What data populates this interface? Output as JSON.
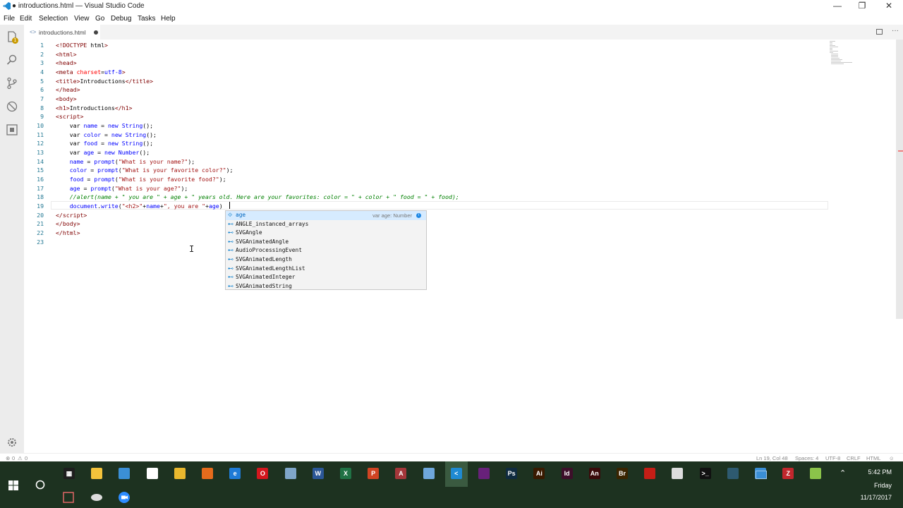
{
  "window": {
    "title": "● introductions.html — Visual Studio Code"
  },
  "menu": [
    "File",
    "Edit",
    "Selection",
    "View",
    "Go",
    "Debug",
    "Tasks",
    "Help"
  ],
  "activity": {
    "git_badge": "1"
  },
  "tab": {
    "label": "introductions.html"
  },
  "editor": {
    "line_numbers": [
      "1",
      "2",
      "3",
      "4",
      "5",
      "6",
      "7",
      "8",
      "9",
      "10",
      "11",
      "12",
      "13",
      "14",
      "15",
      "16",
      "17",
      "18",
      "19",
      "20",
      "21",
      "22",
      "23"
    ]
  },
  "suggest": {
    "items": [
      {
        "label": "age",
        "detail": "var age: Number"
      },
      {
        "label": "ANGLE_instanced_arrays"
      },
      {
        "label": "SVGAngle"
      },
      {
        "label": "SVGAnimatedAngle"
      },
      {
        "label": "AudioProcessingEvent"
      },
      {
        "label": "SVGAnimatedLength"
      },
      {
        "label": "SVGAnimatedLengthList"
      },
      {
        "label": "SVGAnimatedInteger"
      },
      {
        "label": "SVGAnimatedString"
      }
    ]
  },
  "status": {
    "errors": "0",
    "warnings": "0",
    "position": "Ln 19, Col 48",
    "spaces": "Spaces: 4",
    "encoding": "UTF-8",
    "eol": "CRLF",
    "language": "HTML"
  },
  "taskbar": {
    "time": "5:42 PM",
    "day": "Friday",
    "date": "11/17/2017",
    "apps": [
      {
        "name": "calculator",
        "color": "#1e1e1e",
        "glyph": "▦"
      },
      {
        "name": "file-explorer",
        "color": "#f3c33b",
        "glyph": ""
      },
      {
        "name": "cloud",
        "color": "#3b8fd6",
        "glyph": ""
      },
      {
        "name": "dropbox",
        "color": "#ffffff",
        "glyph": ""
      },
      {
        "name": "chrome",
        "color": "#e9b82e",
        "glyph": ""
      },
      {
        "name": "firefox",
        "color": "#e66b1c",
        "glyph": ""
      },
      {
        "name": "edge",
        "color": "#1f7bd6",
        "glyph": "e"
      },
      {
        "name": "opera",
        "color": "#d3171e",
        "glyph": "O"
      },
      {
        "name": "network",
        "color": "#7fa6c9",
        "glyph": ""
      },
      {
        "name": "word",
        "color": "#2b5797",
        "glyph": "W"
      },
      {
        "name": "excel",
        "color": "#207245",
        "glyph": "X"
      },
      {
        "name": "powerpoint",
        "color": "#d04423",
        "glyph": "P"
      },
      {
        "name": "access",
        "color": "#a4373a",
        "glyph": "A"
      },
      {
        "name": "paint",
        "color": "#6fa8dc",
        "glyph": ""
      },
      {
        "name": "vscode",
        "color": "#1f8ad2",
        "glyph": "<"
      },
      {
        "name": "visual-studio",
        "color": "#68217a",
        "glyph": ""
      },
      {
        "name": "photoshop",
        "color": "#0f2b40",
        "glyph": "Ps"
      },
      {
        "name": "illustrator",
        "color": "#3a1a00",
        "glyph": "Ai"
      },
      {
        "name": "indesign",
        "color": "#3d0f2a",
        "glyph": "Id"
      },
      {
        "name": "animate",
        "color": "#3a0a0a",
        "glyph": "An"
      },
      {
        "name": "bridge",
        "color": "#3a2400",
        "glyph": "Br"
      },
      {
        "name": "acrobat",
        "color": "#c41e16",
        "glyph": ""
      },
      {
        "name": "network-tool",
        "color": "#dddddd",
        "glyph": ""
      },
      {
        "name": "terminal",
        "color": "#111111",
        "glyph": ">_"
      },
      {
        "name": "brackets",
        "color": "#2e5a70",
        "glyph": ""
      },
      {
        "name": "monitor",
        "color": "#3b8fd6",
        "glyph": ""
      },
      {
        "name": "filezilla",
        "color": "#c1272d",
        "glyph": "Z"
      },
      {
        "name": "notepad-plus",
        "color": "#8bc34a",
        "glyph": ""
      }
    ]
  }
}
